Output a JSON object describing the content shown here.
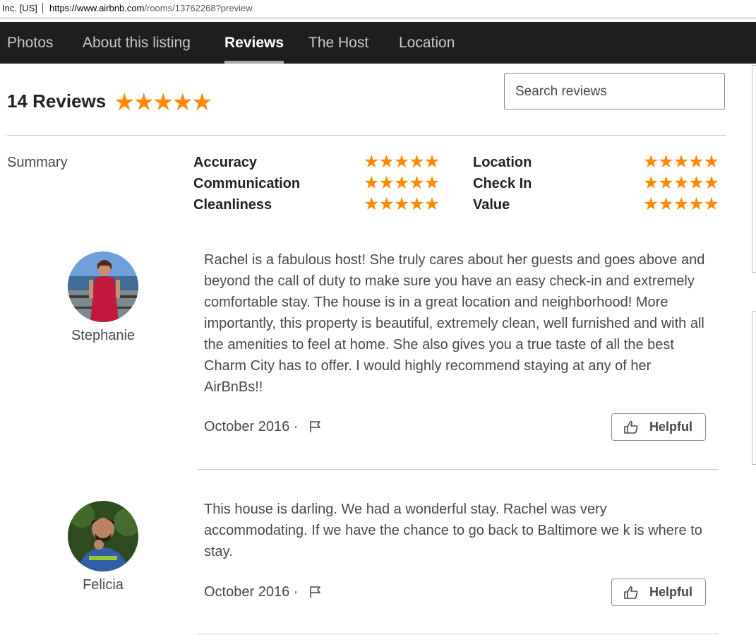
{
  "browser": {
    "cert_label": "Inc. [US]",
    "url_host": "https://www.airbnb.com",
    "url_path": "/rooms/13762268?preview"
  },
  "nav": {
    "tabs": [
      {
        "label": "Photos",
        "active": false
      },
      {
        "label": "About this listing",
        "active": false
      },
      {
        "label": "Reviews",
        "active": true
      },
      {
        "label": "The Host",
        "active": false
      },
      {
        "label": "Location",
        "active": false
      }
    ]
  },
  "reviews_header": {
    "title": "14 Reviews",
    "overall_rating": 5,
    "search_placeholder": "Search reviews"
  },
  "summary": {
    "label": "Summary",
    "categories": [
      {
        "label": "Accuracy",
        "rating": 5
      },
      {
        "label": "Communication",
        "rating": 5
      },
      {
        "label": "Cleanliness",
        "rating": 5
      },
      {
        "label": "Location",
        "rating": 5
      },
      {
        "label": "Check In",
        "rating": 5
      },
      {
        "label": "Value",
        "rating": 5
      }
    ]
  },
  "reviews": [
    {
      "name": "Stephanie",
      "text": "Rachel is a fabulous host! She truly cares about her guests and goes above and beyond the call of duty to make sure you have an easy check-in and extremely comfortable stay. The house is in a great location and neighborhood! More importantly, this property is beautiful, extremely clean, well furnished and with all the amenities to feel at home. She also gives you a true taste of all the best Charm City has to offer. I would highly recommend staying at any of her AirBnBs!!",
      "date": "October 2016 ·",
      "helpful_label": "Helpful"
    },
    {
      "name": "Felicia",
      "text": "This house is darling. We had a wonderful stay. Rachel was very accommodating. If we have the chance to go back to Baltimore we k is where to stay.",
      "date": "October 2016 ·",
      "helpful_label": "Helpful"
    }
  ],
  "colors": {
    "star": "#ff8a00",
    "nav_bg": "#1e1e1e",
    "text": "#484848"
  },
  "icons": {
    "star": "star-icon",
    "flag": "flag-icon",
    "thumb": "thumbs-up-icon"
  }
}
